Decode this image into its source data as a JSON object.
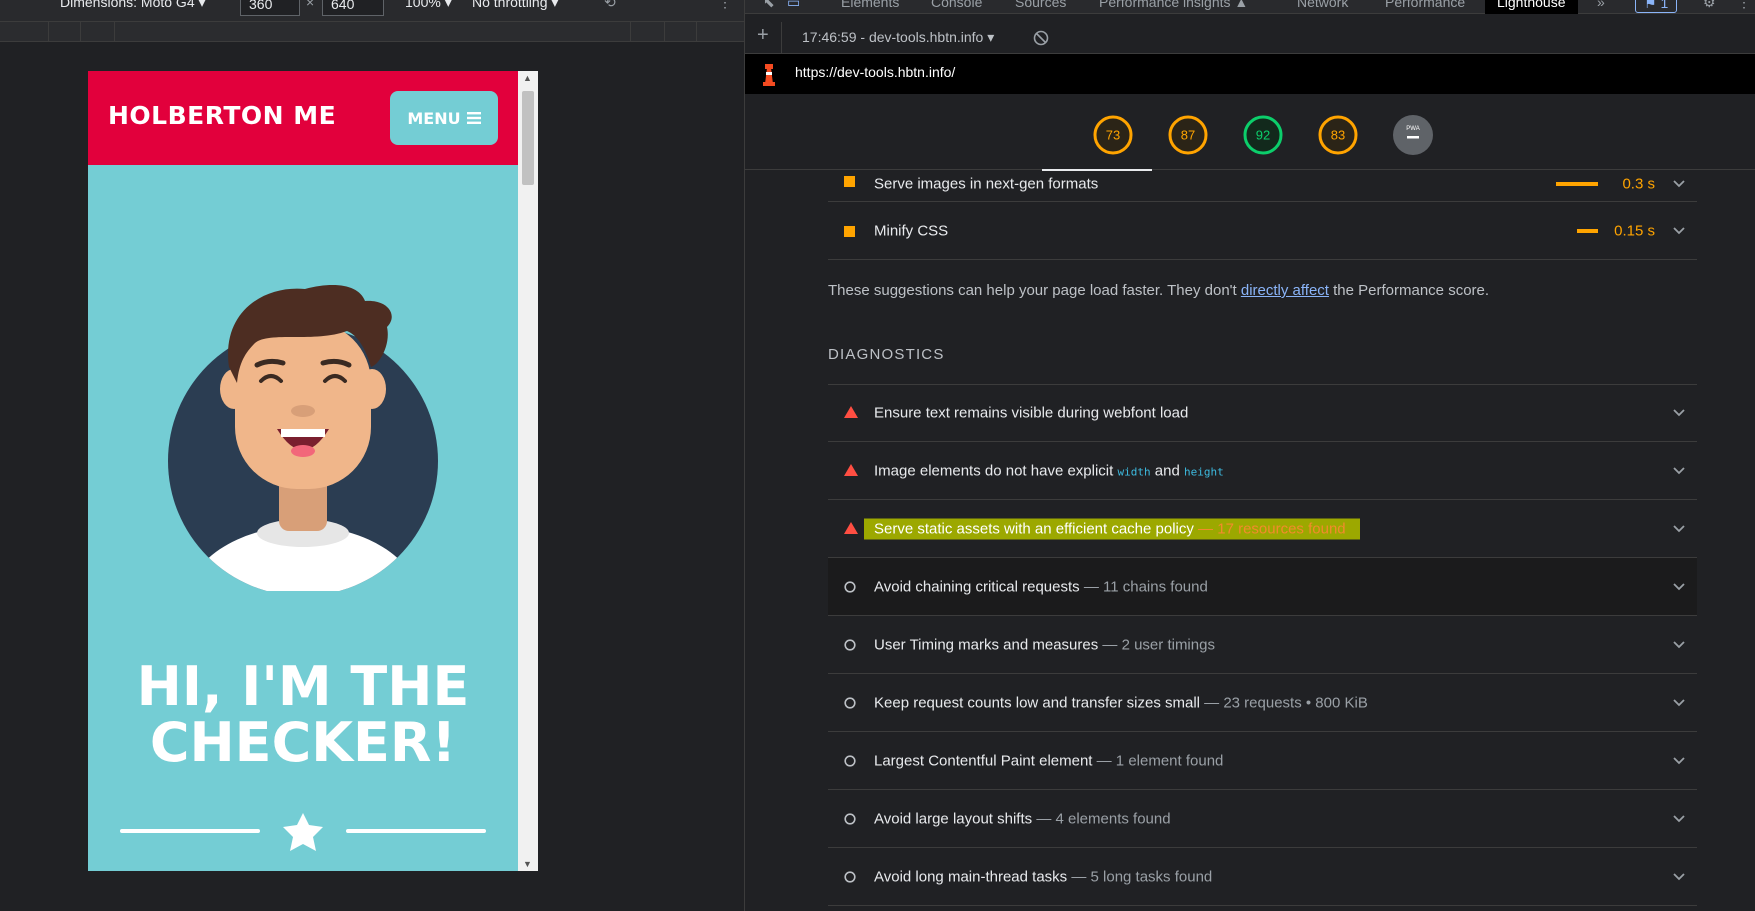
{
  "devtools_device_bar": {
    "dimensions_label": "Dimensions: Moto G4",
    "width_value": "360",
    "times": "×",
    "height_value": "640",
    "zoom": "100%",
    "throttling": "No throttling"
  },
  "phone_page": {
    "brand": "HOLBERTON ME",
    "menu_label": "MENU",
    "hero_line1": "HI, I'M THE",
    "hero_line2": "CHECKER!"
  },
  "devtools_tabs": {
    "elements": "Elements",
    "console": "Console",
    "sources": "Sources",
    "performance_insights": "Performance insights",
    "network": "Network",
    "performance": "Performance",
    "lighthouse": "Lighthouse",
    "issues_count": "1"
  },
  "toolbar": {
    "report_select": "17:46:59 - dev-tools.hbtn.info"
  },
  "url": "https://dev-tools.hbtn.info/",
  "scores": {
    "s1": "73",
    "s2": "87",
    "s3": "92",
    "s4": "83",
    "pwa": "PWA"
  },
  "score_colors": {
    "average": "#ffa400",
    "pass": "#0cce6b",
    "neutral": "#5f6368"
  },
  "opportunities": [
    {
      "title": "Serve images in next-gen formats",
      "value": "0.3 s"
    },
    {
      "title": "Minify CSS",
      "value": "0.15 s"
    }
  ],
  "suggestion": {
    "before": "These suggestions can help your page load faster. They don't ",
    "link": "directly affect",
    "after": " the Performance score."
  },
  "diagnostics_heading": "DIAGNOSTICS",
  "diagnostics": {
    "d1": {
      "title": "Ensure text remains visible during webfont load"
    },
    "d2": {
      "title_a": "Image elements do not have explicit ",
      "code1": "width",
      "title_b": " and ",
      "code2": "height"
    },
    "d3": {
      "title": "Serve static assets with an efficient cache policy",
      "detail": " — 17 resources found"
    },
    "d4": {
      "title": "Avoid chaining critical requests",
      "detail": " — 11 chains found"
    },
    "d5": {
      "title": "User Timing marks and measures",
      "detail": " — 2 user timings"
    },
    "d6": {
      "title": "Keep request counts low and transfer sizes small",
      "detail": " — 23 requests • 800 KiB"
    },
    "d7": {
      "title": "Largest Contentful Paint element",
      "detail": " — 1 element found"
    },
    "d8": {
      "title": "Avoid large layout shifts",
      "detail": " — 4 elements found"
    },
    "d9": {
      "title": "Avoid long main-thread tasks",
      "detail": " — 5 long tasks found"
    }
  }
}
